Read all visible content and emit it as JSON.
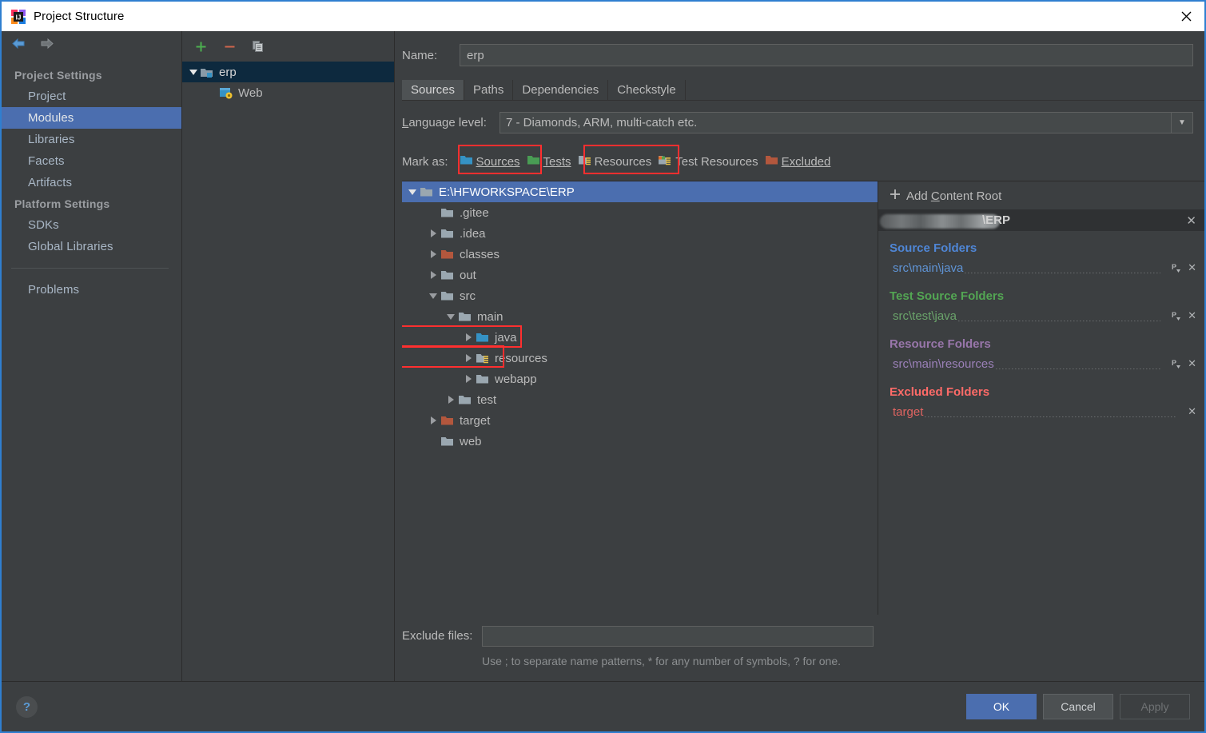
{
  "window": {
    "title": "Project Structure",
    "app_icon": "intellij-idea-icon",
    "close_label": "✕"
  },
  "nav": {
    "back_icon": "arrow-left-icon",
    "forward_icon": "arrow-right-icon"
  },
  "sidebar": {
    "groups": [
      {
        "label": "Project Settings",
        "items": [
          {
            "label": "Project",
            "selected": false
          },
          {
            "label": "Modules",
            "selected": true
          },
          {
            "label": "Libraries",
            "selected": false
          },
          {
            "label": "Facets",
            "selected": false
          },
          {
            "label": "Artifacts",
            "selected": false
          }
        ]
      },
      {
        "label": "Platform Settings",
        "items": [
          {
            "label": "SDKs",
            "selected": false
          },
          {
            "label": "Global Libraries",
            "selected": false
          }
        ]
      }
    ],
    "footer_items": [
      {
        "label": "Problems",
        "selected": false
      }
    ]
  },
  "module_panel": {
    "toolbar": [
      {
        "name": "add-module-button",
        "glyph": "+"
      },
      {
        "name": "remove-module-button",
        "glyph": "−"
      },
      {
        "name": "copy-module-button",
        "glyph": "copy-icon"
      }
    ],
    "tree": [
      {
        "label": "erp",
        "icon": "module-folder-icon",
        "expanded": true,
        "depth": 0,
        "selected": true
      },
      {
        "label": "Web",
        "icon": "web-facet-icon",
        "expanded": null,
        "depth": 1,
        "selected": false
      }
    ]
  },
  "main": {
    "name_label": "Name:",
    "name_value": "erp",
    "tabs": [
      {
        "label": "Sources",
        "active": true
      },
      {
        "label": "Paths",
        "active": false
      },
      {
        "label": "Dependencies",
        "active": false
      },
      {
        "label": "Checkstyle",
        "active": false
      }
    ],
    "language_level_label": "Language level:",
    "language_level_value": "7 - Diamonds, ARM, multi-catch etc.",
    "mark_as_label": "Mark as:",
    "mark_as_options": [
      {
        "label": "Sources",
        "mnemonic": "S",
        "icon": "sources-folder-icon",
        "color": "#3592c4",
        "highlighted": true
      },
      {
        "label": "Tests",
        "mnemonic": "T",
        "icon": "tests-folder-icon",
        "color": "#499c54",
        "highlighted": false
      },
      {
        "label": "Resources",
        "mnemonic": "",
        "icon": "resources-folder-icon",
        "color": "#9aa7b0",
        "highlighted": true
      },
      {
        "label": "Test Resources",
        "mnemonic": "",
        "icon": "test-resources-folder-icon",
        "color": "#9aa7b0",
        "highlighted": false
      },
      {
        "label": "Excluded",
        "mnemonic": "E",
        "icon": "excluded-folder-icon",
        "color": "#b3573d",
        "highlighted": false
      }
    ],
    "exclude_files_label": "Exclude files:",
    "exclude_files_value": "",
    "exclude_files_hint": "Use ; to separate name patterns, * for any number of symbols, ? for one."
  },
  "content_tree": [
    {
      "label": "E:\\HFWORKSPACE\\ERP",
      "depth": 0,
      "arrow": "down",
      "folder": "content-root",
      "selected": true,
      "highlighted": false
    },
    {
      "label": ".gitee",
      "depth": 1,
      "arrow": "none",
      "folder": "plain",
      "selected": false,
      "highlighted": false
    },
    {
      "label": ".idea",
      "depth": 1,
      "arrow": "right",
      "folder": "plain",
      "selected": false,
      "highlighted": false
    },
    {
      "label": "classes",
      "depth": 1,
      "arrow": "right",
      "folder": "excluded",
      "selected": false,
      "highlighted": false
    },
    {
      "label": "out",
      "depth": 1,
      "arrow": "right",
      "folder": "plain",
      "selected": false,
      "highlighted": false
    },
    {
      "label": "src",
      "depth": 1,
      "arrow": "down",
      "folder": "plain",
      "selected": false,
      "highlighted": false
    },
    {
      "label": "main",
      "depth": 2,
      "arrow": "down",
      "folder": "plain",
      "selected": false,
      "highlighted": false
    },
    {
      "label": "java",
      "depth": 3,
      "arrow": "right",
      "folder": "sources",
      "selected": false,
      "highlighted": true
    },
    {
      "label": "resources",
      "depth": 3,
      "arrow": "right",
      "folder": "resources",
      "selected": false,
      "highlighted": true
    },
    {
      "label": "webapp",
      "depth": 3,
      "arrow": "right",
      "folder": "plain",
      "selected": false,
      "highlighted": false
    },
    {
      "label": "test",
      "depth": 2,
      "arrow": "right",
      "folder": "plain",
      "selected": false,
      "highlighted": false
    },
    {
      "label": "target",
      "depth": 1,
      "arrow": "right",
      "folder": "excluded",
      "selected": false,
      "highlighted": false
    },
    {
      "label": "web",
      "depth": 1,
      "arrow": "none",
      "folder": "plain",
      "selected": false,
      "highlighted": false
    }
  ],
  "detail": {
    "add_content_root_label": "Add Content Root",
    "add_icon": "plus-icon",
    "content_root": {
      "path_visible": "\\ERP",
      "path_redacted": true,
      "remove_icon": "close-icon"
    },
    "groups": [
      {
        "title": "Source Folders",
        "kind": "src",
        "paths": [
          {
            "path": "src\\main\\java",
            "has_prefix_button": true,
            "prefix_icon": "package-prefix-icon",
            "remove_icon": "close-icon"
          }
        ]
      },
      {
        "title": "Test Source Folders",
        "kind": "test",
        "paths": [
          {
            "path": "src\\test\\java",
            "has_prefix_button": true,
            "prefix_icon": "package-prefix-icon",
            "remove_icon": "close-icon"
          }
        ]
      },
      {
        "title": "Resource Folders",
        "kind": "res",
        "paths": [
          {
            "path": "src\\main\\resources",
            "has_prefix_button": true,
            "prefix_icon": "package-prefix-icon",
            "remove_icon": "close-icon"
          }
        ]
      },
      {
        "title": "Excluded Folders",
        "kind": "exc",
        "paths": [
          {
            "path": "target",
            "has_prefix_button": false,
            "prefix_icon": "",
            "remove_icon": "close-icon"
          }
        ]
      }
    ]
  },
  "footer": {
    "help_icon": "question-mark-icon",
    "buttons": [
      {
        "label": "OK",
        "style": "primary"
      },
      {
        "label": "Cancel",
        "style": "normal"
      },
      {
        "label": "Apply",
        "style": "disabled"
      }
    ]
  },
  "colors": {
    "accent_blue": "#4b6eaf",
    "highlight_red": "#ff2f2f",
    "panel_bg": "#3c3f41",
    "source_blue": "#4f86d6",
    "test_green": "#53a653",
    "resource_purple": "#9876aa",
    "excluded_red": "#ff6b68"
  }
}
